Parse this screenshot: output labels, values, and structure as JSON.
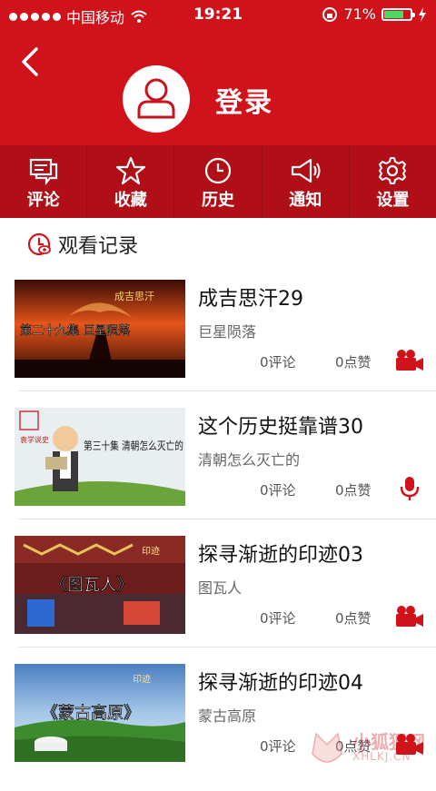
{
  "status": {
    "carrier": "中国移动",
    "time": "19:21",
    "battery": "71%"
  },
  "profile": {
    "login_label": "登录"
  },
  "nav": [
    {
      "label": "评论",
      "icon": "comment-icon"
    },
    {
      "label": "收藏",
      "icon": "star-icon"
    },
    {
      "label": "历史",
      "icon": "clock-icon"
    },
    {
      "label": "通知",
      "icon": "megaphone-icon"
    },
    {
      "label": "设置",
      "icon": "gear-icon"
    }
  ],
  "section": {
    "title": "观看记录"
  },
  "history": [
    {
      "title": "成吉思汗29",
      "subtitle": "巨星陨落",
      "comments": "0评论",
      "likes": "0点赞",
      "media": "video-camera-icon",
      "thumb_text": "第二十九集  巨星陨落",
      "thumb_logo": "成吉思汗"
    },
    {
      "title": "这个历史挺靠谱30",
      "subtitle": "清朝怎么灭亡的",
      "comments": "0评论",
      "likes": "0点赞",
      "media": "microphone-icon",
      "thumb_text": "第三十集 清朝怎么灭亡的",
      "thumb_logo": "袁学说史"
    },
    {
      "title": "探寻渐逝的印迹03",
      "subtitle": "图瓦人",
      "comments": "0评论",
      "likes": "0点赞",
      "media": "video-camera-icon",
      "thumb_text": "《图瓦人》",
      "thumb_logo": "印迹"
    },
    {
      "title": "探寻渐逝的印迹04",
      "subtitle": "蒙古高原",
      "comments": "0评论",
      "likes": "0点赞",
      "media": "video-camera-icon",
      "thumb_text": "《蒙古高原》",
      "thumb_logo": "印迹"
    }
  ],
  "watermark": {
    "text": "小狐狸网",
    "sub": "XHLKJ.CN"
  },
  "colors": {
    "brand": "#d0121b",
    "nav_bg": "#b10f17"
  }
}
